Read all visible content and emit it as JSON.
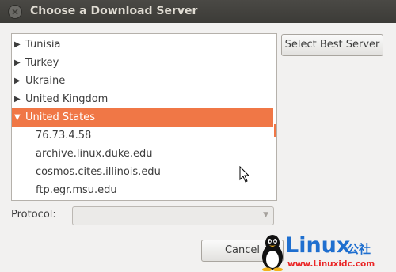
{
  "window": {
    "title": "Choose a Download Server",
    "close_glyph": "×"
  },
  "server_list": {
    "items": [
      {
        "label": "Tunisia",
        "arrow": "▶"
      },
      {
        "label": "Turkey",
        "arrow": "▶"
      },
      {
        "label": "Ukraine",
        "arrow": "▶"
      },
      {
        "label": "United Kingdom",
        "arrow": "▶"
      },
      {
        "label": "United States",
        "arrow": "▼",
        "selected": true
      },
      {
        "label": "76.73.4.58"
      },
      {
        "label": "archive.linux.duke.edu"
      },
      {
        "label": "cosmos.cites.illinois.edu"
      },
      {
        "label": "ftp.egr.msu.edu"
      }
    ]
  },
  "buttons": {
    "select_best": "Select Best Server",
    "cancel": "Cancel"
  },
  "protocol": {
    "label": "Protocol:",
    "value": ""
  },
  "watermark": {
    "brand": "Linux",
    "cn": "公社",
    "url": "www.Linuxidc.com"
  },
  "colors": {
    "accent": "#f07746",
    "titlebar": "#3c3b37",
    "background": "#f2f1f0",
    "watermark_blue": "#1f6fcf",
    "watermark_red": "#ea2424"
  },
  "icons": {
    "collapsed": "triangle-right-icon",
    "expanded": "triangle-down-icon",
    "cursor": "mouse-pointer-icon"
  }
}
